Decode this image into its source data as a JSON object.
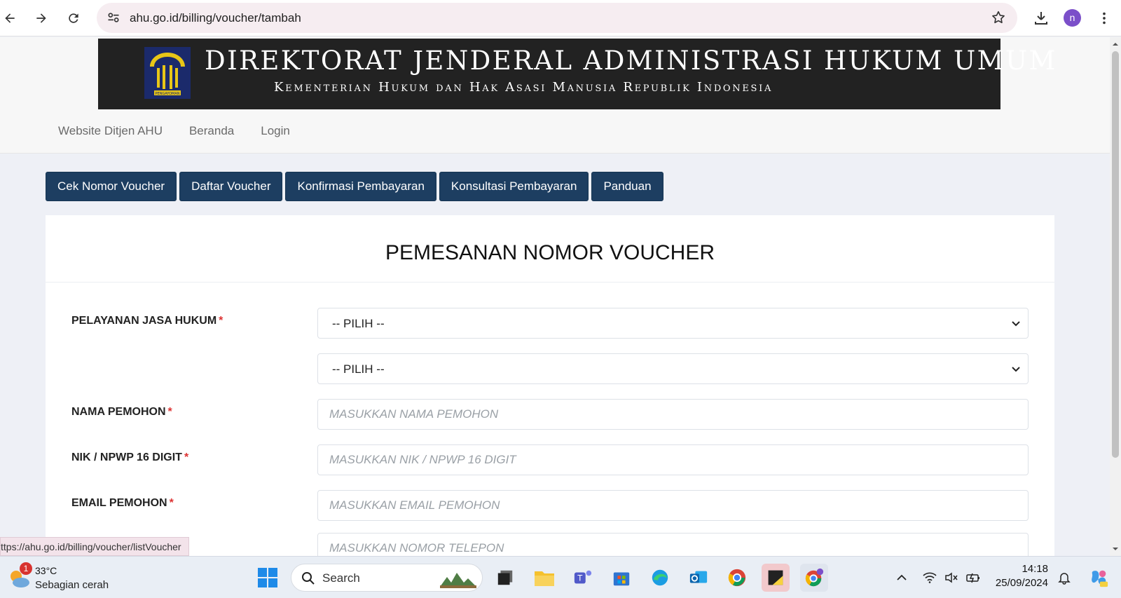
{
  "browser": {
    "url": "ahu.go.id/billing/voucher/tambah",
    "profile_initial": "n"
  },
  "banner": {
    "title": "DIREKTORAT JENDERAL ADMINISTRASI HUKUM UMUM",
    "subtitle": "Kementerian Hukum dan Hak Asasi Manusia Republik Indonesia",
    "emblem_text": "PENGAYOMAN"
  },
  "top_nav": [
    {
      "label": "Website Ditjen AHU"
    },
    {
      "label": "Beranda"
    },
    {
      "label": "Login"
    }
  ],
  "tabs": [
    {
      "label": "Cek Nomor Voucher"
    },
    {
      "label": "Daftar Voucher"
    },
    {
      "label": "Konfirmasi Pembayaran"
    },
    {
      "label": "Konsultasi Pembayaran"
    },
    {
      "label": "Panduan"
    }
  ],
  "form": {
    "title": "PEMESANAN NOMOR VOUCHER",
    "required_mark": "*",
    "pelayanan_label": "PELAYANAN JASA HUKUM",
    "select1_value": "-- PILIH --",
    "select2_value": "-- PILIH --",
    "nama_label": "NAMA PEMOHON",
    "nama_placeholder": "MASUKKAN NAMA PEMOHON",
    "nik_label": "NIK / NPWP 16 DIGIT",
    "nik_placeholder": "MASUKKAN NIK / NPWP 16 DIGIT",
    "email_label": "EMAIL PEMOHON",
    "email_placeholder": "MASUKKAN EMAIL PEMOHON",
    "telepon_placeholder": "MASUKKAN NOMOR TELEPON"
  },
  "status_url": "ttps://ahu.go.id/billing/voucher/listVoucher",
  "taskbar": {
    "weather_badge": "1",
    "temperature": "33°C",
    "condition": "Sebagian cerah",
    "search_label": "Search",
    "time": "14:18",
    "date": "25/09/2024"
  },
  "colors": {
    "tab_bg": "#1d3e61",
    "banner_bg": "#222222",
    "required": "#dd3333"
  }
}
